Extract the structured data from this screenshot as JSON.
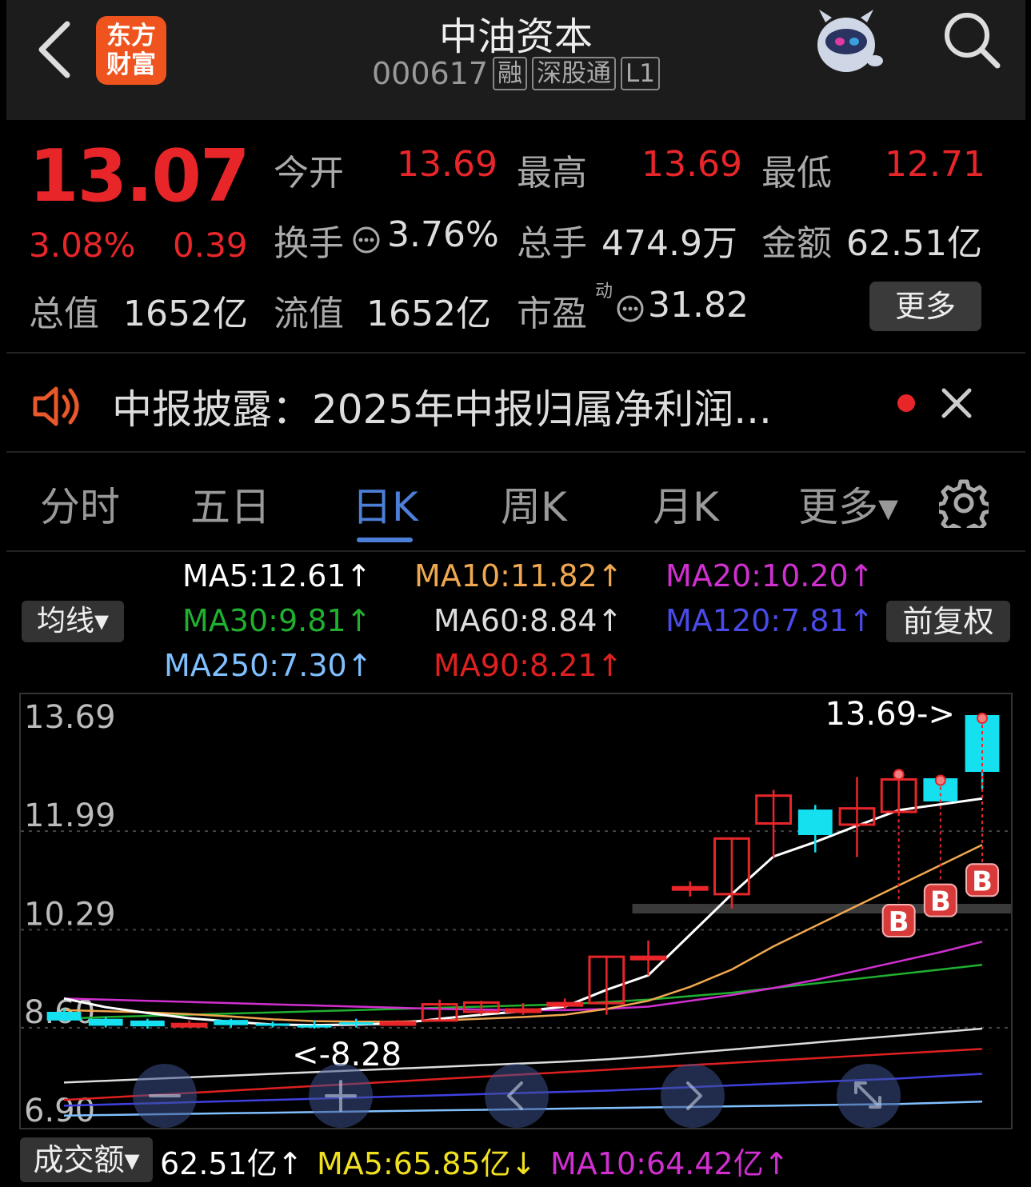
{
  "header": {
    "back_icon": "chevron-left-icon",
    "logo_text_1": "东方",
    "logo_text_2": "财富",
    "title": "中油资本",
    "code": "000617",
    "tags": [
      "融",
      "深股通",
      "L1"
    ],
    "robot_icon": "robot-assistant-icon",
    "search_icon": "search-icon"
  },
  "quote": {
    "price": "13.07",
    "change_pct": "3.08%",
    "change": "0.39",
    "open_label": "今开",
    "open": "13.69",
    "high_label": "最高",
    "high": "13.69",
    "low_label": "最低",
    "low": "12.71",
    "turnover_label": "换手",
    "turnover": "3.76%",
    "volume_label": "总手",
    "volume": "474.9万",
    "amount_label": "金额",
    "amount": "62.51亿",
    "mktcap_label": "总值",
    "mktcap": "1652亿",
    "float_label": "流值",
    "float_cap": "1652亿",
    "pe_label": "市盈",
    "pe_sup": "动",
    "pe": "31.82",
    "more_label": "更多"
  },
  "news": {
    "icon": "speaker-icon",
    "text": "中报披露：2025年中报归属净利润...",
    "close_icon": "close-icon"
  },
  "tabs": [
    "分时",
    "五日",
    "日K",
    "周K",
    "月K",
    "更多▾"
  ],
  "active_tab": "日K",
  "settings_icon": "gear-icon",
  "ma_legend": {
    "ma5": "MA5:12.61↑",
    "ma10": "MA10:11.82↑",
    "ma20": "MA20:10.20↑",
    "ma30": "MA30:9.81↑",
    "ma60": "MA60:8.84↑",
    "ma120": "MA120:7.81↑",
    "ma250": "MA250:7.30↑",
    "ma90": "MA90:8.21↑",
    "junxian_label": "均线▾",
    "fuquan_label": "前复权"
  },
  "colors": {
    "up": "#e8262a",
    "down": "#14e0f0",
    "ma5": "#ffffff",
    "ma10": "#f0a850",
    "ma20": "#d030d0",
    "ma30": "#20b030",
    "ma60": "#dddddd",
    "ma120": "#4040e0",
    "ma250": "#80c0ff",
    "ma90": "#e02020"
  },
  "chart_data": {
    "type": "candlestick",
    "y_ticks": [
      "13.69",
      "11.99",
      "10.29",
      "8.60",
      "6.90"
    ],
    "ylim": [
      6.9,
      13.69
    ],
    "max_label": "13.69->",
    "min_label": "<-8.28",
    "candles": [
      {
        "o": 8.57,
        "c": 8.42,
        "h": 8.62,
        "l": 8.4
      },
      {
        "o": 8.45,
        "c": 8.33,
        "h": 8.48,
        "l": 8.3
      },
      {
        "o": 8.42,
        "c": 8.32,
        "h": 8.45,
        "l": 8.28
      },
      {
        "o": 8.36,
        "c": 8.36,
        "h": 8.42,
        "l": 8.33
      },
      {
        "o": 8.43,
        "c": 8.34,
        "h": 8.45,
        "l": 8.3
      },
      {
        "o": 8.37,
        "c": 8.33,
        "h": 8.4,
        "l": 8.3
      },
      {
        "o": 8.34,
        "c": 8.33,
        "h": 8.42,
        "l": 8.28
      },
      {
        "o": 8.39,
        "c": 8.38,
        "h": 8.45,
        "l": 8.3
      },
      {
        "o": 8.39,
        "c": 8.39,
        "h": 8.43,
        "l": 8.33
      },
      {
        "o": 8.42,
        "c": 8.7,
        "h": 8.78,
        "l": 8.4
      },
      {
        "o": 8.57,
        "c": 8.73,
        "h": 8.76,
        "l": 8.52
      },
      {
        "o": 8.57,
        "c": 8.61,
        "h": 8.72,
        "l": 8.52
      },
      {
        "o": 8.72,
        "c": 8.72,
        "h": 8.8,
        "l": 8.62
      },
      {
        "o": 8.72,
        "c": 9.52,
        "h": 9.54,
        "l": 8.52
      },
      {
        "o": 9.52,
        "c": 9.52,
        "h": 9.8,
        "l": 9.2
      },
      {
        "o": 10.68,
        "c": 10.72,
        "h": 10.82,
        "l": 10.56
      },
      {
        "o": 10.6,
        "c": 11.56,
        "h": 11.58,
        "l": 10.35
      },
      {
        "o": 11.82,
        "c": 12.3,
        "h": 12.4,
        "l": 11.24
      },
      {
        "o": 12.06,
        "c": 11.62,
        "h": 12.14,
        "l": 11.32
      },
      {
        "o": 11.8,
        "c": 12.08,
        "h": 12.62,
        "l": 11.24
      },
      {
        "o": 12.02,
        "c": 12.58,
        "h": 12.72,
        "l": 11.96
      },
      {
        "o": 12.6,
        "c": 12.2,
        "h": 12.62,
        "l": 12.18
      },
      {
        "o": 13.69,
        "c": 12.71,
        "h": 13.69,
        "l": 12.4
      }
    ],
    "ma_lines": {
      "ma5": [
        8.8,
        8.65,
        8.55,
        8.46,
        8.4,
        8.35,
        8.34,
        8.35,
        8.37,
        8.45,
        8.52,
        8.58,
        8.66,
        8.95,
        9.2,
        9.9,
        10.6,
        11.25,
        11.5,
        11.78,
        12.05,
        12.15,
        12.25
      ],
      "ma10": [
        8.6,
        8.58,
        8.56,
        8.53,
        8.49,
        8.44,
        8.41,
        8.4,
        8.4,
        8.42,
        8.45,
        8.48,
        8.52,
        8.62,
        8.76,
        9.0,
        9.3,
        9.7,
        10.05,
        10.4,
        10.75,
        11.1,
        11.45
      ],
      "ma20": [
        8.8,
        8.78,
        8.76,
        8.74,
        8.72,
        8.7,
        8.68,
        8.66,
        8.64,
        8.62,
        8.61,
        8.6,
        8.6,
        8.62,
        8.66,
        8.76,
        8.86,
        8.98,
        9.12,
        9.28,
        9.44,
        9.6,
        9.78
      ],
      "ma30": [
        8.45,
        8.48,
        8.5,
        8.52,
        8.54,
        8.56,
        8.58,
        8.6,
        8.62,
        8.64,
        8.66,
        8.68,
        8.7,
        8.74,
        8.78,
        8.84,
        8.9,
        8.98,
        9.06,
        9.14,
        9.22,
        9.3,
        9.38
      ],
      "ma60": [
        7.35,
        7.38,
        7.41,
        7.44,
        7.47,
        7.5,
        7.53,
        7.56,
        7.59,
        7.62,
        7.65,
        7.68,
        7.71,
        7.75,
        7.8,
        7.86,
        7.92,
        7.98,
        8.04,
        8.1,
        8.16,
        8.22,
        8.28
      ],
      "ma90": [
        7.05,
        7.09,
        7.13,
        7.17,
        7.21,
        7.25,
        7.29,
        7.33,
        7.37,
        7.41,
        7.45,
        7.49,
        7.53,
        7.57,
        7.61,
        7.65,
        7.69,
        7.73,
        7.77,
        7.81,
        7.85,
        7.89,
        7.93
      ],
      "ma120": [
        6.95,
        6.97,
        6.99,
        7.01,
        7.03,
        7.05,
        7.07,
        7.09,
        7.11,
        7.13,
        7.15,
        7.17,
        7.19,
        7.21,
        7.24,
        7.27,
        7.3,
        7.33,
        7.36,
        7.39,
        7.42,
        7.46,
        7.5
      ],
      "ma250": [
        6.78,
        6.79,
        6.8,
        6.81,
        6.82,
        6.83,
        6.84,
        6.85,
        6.86,
        6.87,
        6.88,
        6.89,
        6.9,
        6.91,
        6.92,
        6.93,
        6.94,
        6.95,
        6.96,
        6.97,
        6.98,
        7.0,
        7.02
      ]
    },
    "b_markers": [
      {
        "index": 20,
        "label": "B"
      },
      {
        "index": 21,
        "label": "B"
      },
      {
        "index": 22,
        "label": "B"
      }
    ],
    "support_level": 10.35,
    "controls": [
      "zoom-out-icon",
      "zoom-in-icon",
      "pan-left-icon",
      "pan-right-icon",
      "collapse-icon"
    ]
  },
  "volume": {
    "label": "成交额▾",
    "value": "62.51亿↑",
    "ma5": "MA5:65.85亿↓",
    "ma10": "MA10:64.42亿↑"
  }
}
